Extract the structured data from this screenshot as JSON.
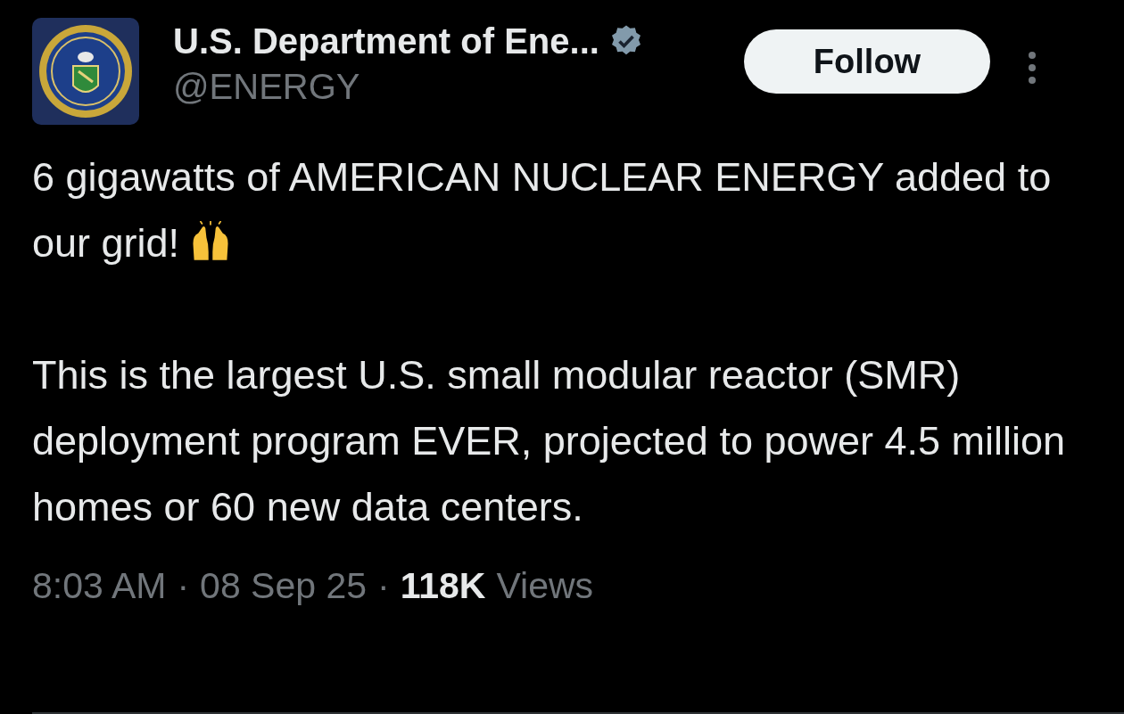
{
  "author": {
    "name": "U.S. Department of Ene...",
    "verified": true,
    "handle": "@ENERGY"
  },
  "follow_button": {
    "label": "Follow"
  },
  "tweet": {
    "paragraphs": [
      {
        "text": "6 gigawatts of AMERICAN NUCLEAR ENERGY added to our grid!",
        "emoji": true
      },
      {
        "text": "This is the largest U.S. small modular reactor (SMR) deployment program EVER, projected to power 4.5 million homes or 60 new data centers.",
        "emoji": false
      }
    ]
  },
  "meta": {
    "time": "8:03 AM",
    "date": "08 Sep 25",
    "separator": "·",
    "views_count": "118K",
    "views_label": "Views"
  }
}
